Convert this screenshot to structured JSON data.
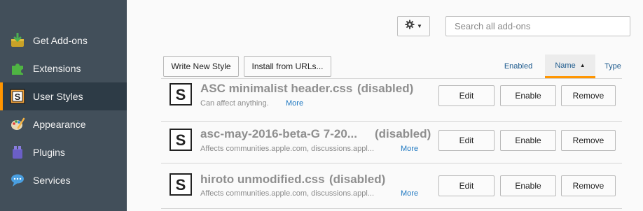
{
  "sidebar": {
    "items": [
      {
        "label": "Get Add-ons",
        "icon": "get-addons-icon"
      },
      {
        "label": "Extensions",
        "icon": "puzzle-icon"
      },
      {
        "label": "User Styles",
        "icon": "stylish-icon"
      },
      {
        "label": "Appearance",
        "icon": "palette-icon"
      },
      {
        "label": "Plugins",
        "icon": "plugin-block-icon"
      },
      {
        "label": "Services",
        "icon": "chat-bubble-icon"
      }
    ],
    "active": "User Styles"
  },
  "toolbar": {
    "gear_icon": "gear-icon",
    "search_placeholder": "Search all add-ons",
    "write_new_style_label": "Write New Style",
    "install_from_urls_label": "Install from URLs..."
  },
  "sort": {
    "enabled_label": "Enabled",
    "name_label": "Name",
    "type_label": "Type",
    "active": "Name",
    "direction": "ascending"
  },
  "styles": [
    {
      "name": "ASC minimalist header.css",
      "status": "(disabled)",
      "description": "Can affect anything.",
      "more_label": "More",
      "edit_label": "Edit",
      "enable_label": "Enable",
      "remove_label": "Remove"
    },
    {
      "name": "asc-may-2016-beta-G 7-20...",
      "status": "(disabled)",
      "description": "Affects communities.apple.com, discussions.appl...",
      "more_label": "More",
      "edit_label": "Edit",
      "enable_label": "Enable",
      "remove_label": "Remove"
    },
    {
      "name": "hiroto unmodified.css",
      "status": "(disabled)",
      "description": "Affects communities.apple.com, discussions.appl...",
      "more_label": "More",
      "edit_label": "Edit",
      "enable_label": "Enable",
      "remove_label": "Remove"
    }
  ],
  "colors": {
    "sidebar_bg": "#424f5a",
    "sidebar_active_bg": "#2d3b46",
    "accent": "#ff9500",
    "link": "#1f78c1"
  }
}
